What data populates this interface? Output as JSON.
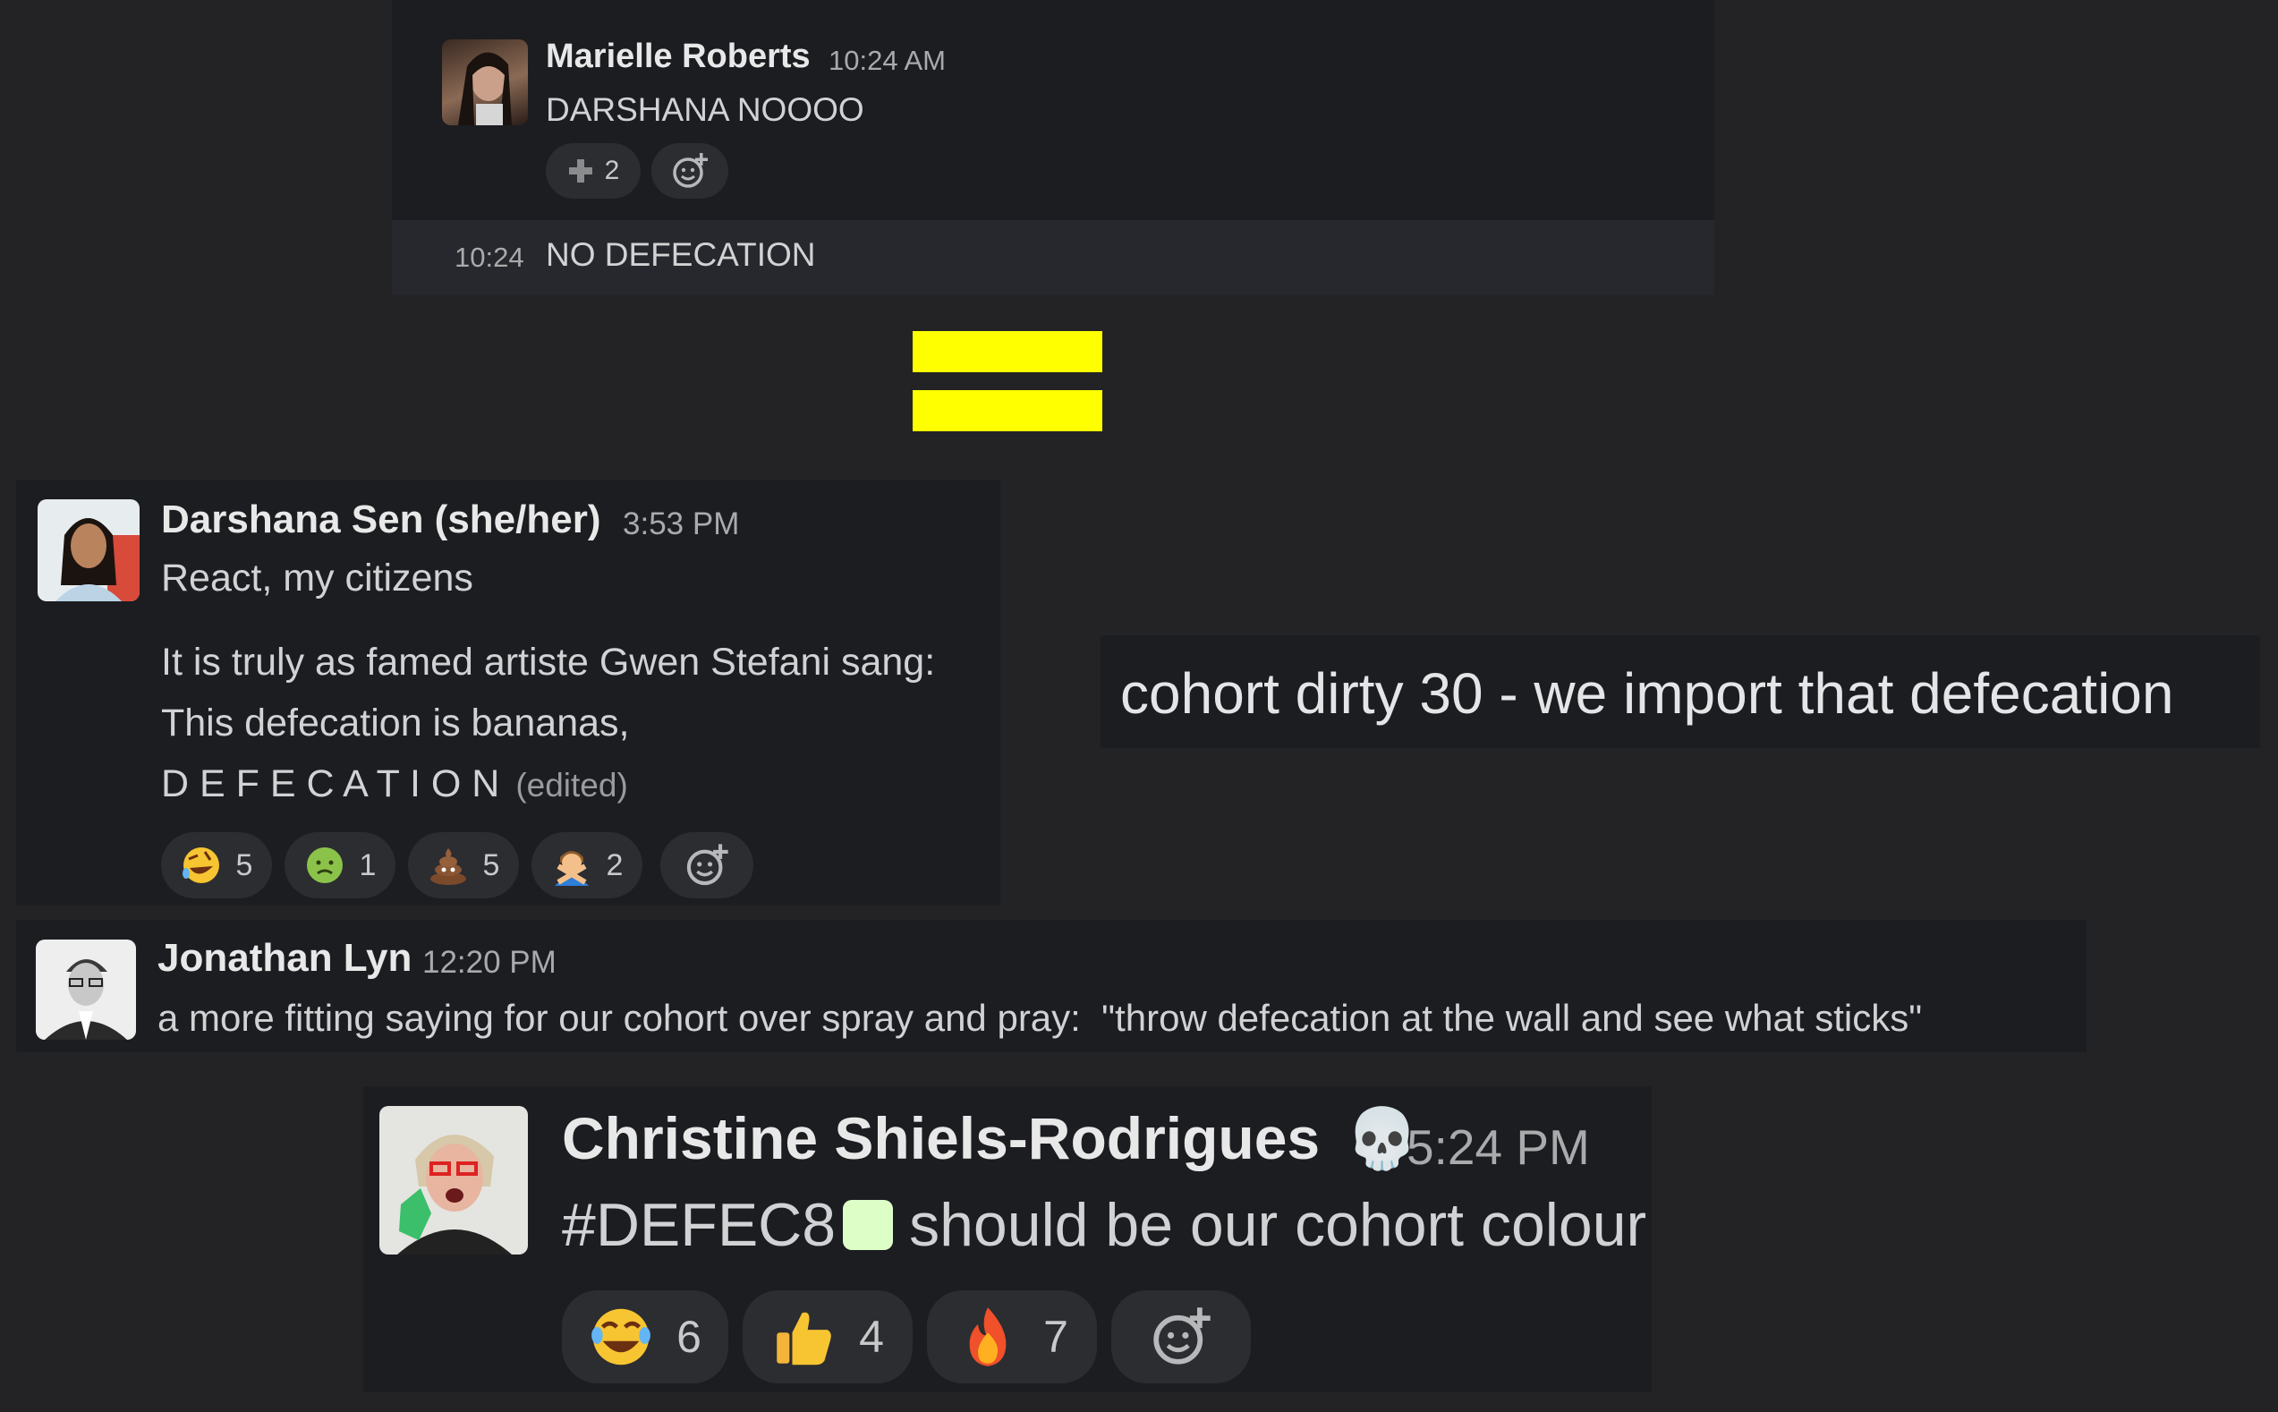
{
  "panel1": {
    "author": "Marielle Roberts",
    "time": "10:24 AM",
    "message": "DARSHANA NOOOO",
    "reactions": [
      {
        "emoji": "heavy-plus-icon",
        "count": "2"
      }
    ],
    "followup_time": "10:24",
    "followup_message": "NO DEFECATION"
  },
  "equals_color": "#ffff00",
  "panel2": {
    "author": "Darshana Sen (she/her)",
    "time": "3:53 PM",
    "line1": "React, my citizens",
    "line2": "It is truly as famed artiste Gwen Stefani sang:",
    "line3": "This defecation is bananas,",
    "line4": "D E F E C A T I O N",
    "edited": "(edited)",
    "reactions": [
      {
        "emoji": "rofl-emoji",
        "count": "5"
      },
      {
        "emoji": "nauseated-emoji",
        "count": "1"
      },
      {
        "emoji": "poop-emoji",
        "count": "5"
      },
      {
        "emoji": "gesturing-no-emoji",
        "count": "2"
      }
    ]
  },
  "caption": "cohort dirty 30 - we import that defecation",
  "panel3": {
    "author": "Jonathan Lyn",
    "time": "12:20 PM",
    "message": "a more fitting saying for our cohort over spray and pray:  \"throw defecation at the wall and see what sticks\""
  },
  "panel4": {
    "author": "Christine Shiels-Rodrigues",
    "author_emoji": "💀",
    "time": "5:24 PM",
    "hex": "#DEFEC8",
    "swatch_color": "#DEFEC8",
    "message": "should be our cohort colour",
    "reactions": [
      {
        "emoji": "joy-emoji",
        "count": "6"
      },
      {
        "emoji": "thumbs-up-emoji",
        "count": "4"
      },
      {
        "emoji": "fire-emoji",
        "count": "7"
      }
    ]
  }
}
